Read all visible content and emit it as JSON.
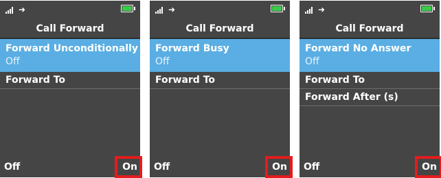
{
  "screens": [
    {
      "title": "Call Forward",
      "selected_item": {
        "label": "Forward Unconditionally",
        "value": "Off"
      },
      "items": [
        {
          "label": "Forward To"
        }
      ],
      "softkeys": {
        "left": "Off",
        "right": "On"
      }
    },
    {
      "title": "Call Forward",
      "selected_item": {
        "label": "Forward Busy",
        "value": "Off"
      },
      "items": [
        {
          "label": "Forward To"
        }
      ],
      "softkeys": {
        "left": "Off",
        "right": "On"
      }
    },
    {
      "title": "Call Forward",
      "selected_item": {
        "label": "Forward No Answer",
        "value": "Off"
      },
      "items": [
        {
          "label": "Forward To"
        },
        {
          "label": "Forward After (s)"
        }
      ],
      "softkeys": {
        "left": "Off",
        "right": "On"
      }
    }
  ],
  "colors": {
    "screen_bg": "#454545",
    "selected_bg": "#5aaee3",
    "battery": "#3cc94a",
    "highlight_box": "#e41c1c"
  },
  "icons": [
    "signal-icon",
    "arrow-right-icon",
    "battery-icon"
  ]
}
